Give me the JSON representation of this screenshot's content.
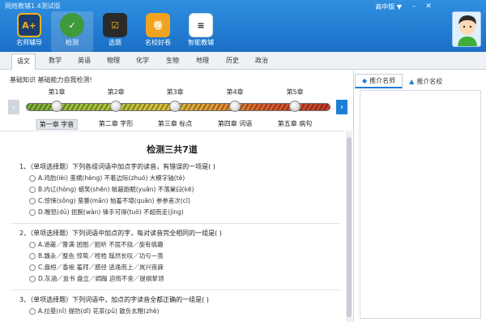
{
  "window": {
    "title": "网络教辅1.4测试版",
    "version_select": "高中版",
    "version_arrow": "▼"
  },
  "toolbar": [
    {
      "label": "名师辅导",
      "icon": "teacher-a-plus-icon",
      "glyph": "A+"
    },
    {
      "label": "检测",
      "icon": "test-robot-icon",
      "glyph": "✓"
    },
    {
      "label": "选题",
      "icon": "select-question-icon",
      "glyph": "☑"
    },
    {
      "label": "名校好卷",
      "icon": "school-paper-icon",
      "glyph": "卷"
    },
    {
      "label": "智能教辅",
      "icon": "smart-tutor-icon",
      "glyph": "≡"
    }
  ],
  "subjects": [
    "语文",
    "数学",
    "英语",
    "物理",
    "化学",
    "生物",
    "地理",
    "历史",
    "政治"
  ],
  "active_subject": "语文",
  "section_title": "基础知识 基础能力自我检测!",
  "chapters": {
    "top_labels": [
      "第1章",
      "第2章",
      "第3章",
      "第4章",
      "第5章"
    ],
    "names": [
      "第一章 字音",
      "第二章 字形",
      "第三章 标点",
      "第四章 词语",
      "第五章 病句"
    ],
    "active": "第一章 字音"
  },
  "quiz": {
    "title": "检测三共7道",
    "questions": [
      {
        "stem": "1、（单项选择题）下列各组词语中加点字的读音，有错误的一项是(    )",
        "options": [
          "A.鸡肋(lèi)   蛮横(hèng)   不着边际(zhuó)   大模字轴(tè)",
          "B.内讧(hòng)   蜡笑(shēn)   眦蔽跑眠(yuān)   不落窠臼(kē)",
          "C.惊悚(sǒng)   蛮萎(mǎn)   恼羞不堪(quān)   参参差次(cī)",
          "D.瞪怒(dù)   扼腕(wàn)   锋手可得(tuō)   不超而走(jìng)"
        ]
      },
      {
        "stem": "2、（单项选择题）下列词语中加点的字，每对读音完全相同的一组是(    )",
        "options": [
          "A.遮蔽／瞥满   团图／韶听   不屈不挠／旋有倩趣",
          "B.魏永／整色   惊鸷／桎梏   蹊然长叹／功亏一篑",
          "C.盘桓／香袍   羞拜／腊径   逃逸而上／岚兴夜寐",
          "D.灰涵／盒书   盘立／绸蹋   迫而不舍／提纲挈领"
        ]
      },
      {
        "stem": "3、（单项选择题）下列词语中，加点的字读音全都正确的一组是(    )",
        "options": [
          "A.拉曼(nǐ)   提防(dī)   花茶(pǔ)   散负玄瞪(zhè)"
        ]
      }
    ]
  },
  "right_panel": {
    "tabs": [
      "推介名师",
      "推介名校"
    ],
    "active_tab": "推介名师"
  },
  "colors": {
    "titlebar": "#1a6fc6",
    "accent": "#1b7fd6",
    "progress_start": "#7cb23a",
    "progress_end": "#c43b2b"
  }
}
